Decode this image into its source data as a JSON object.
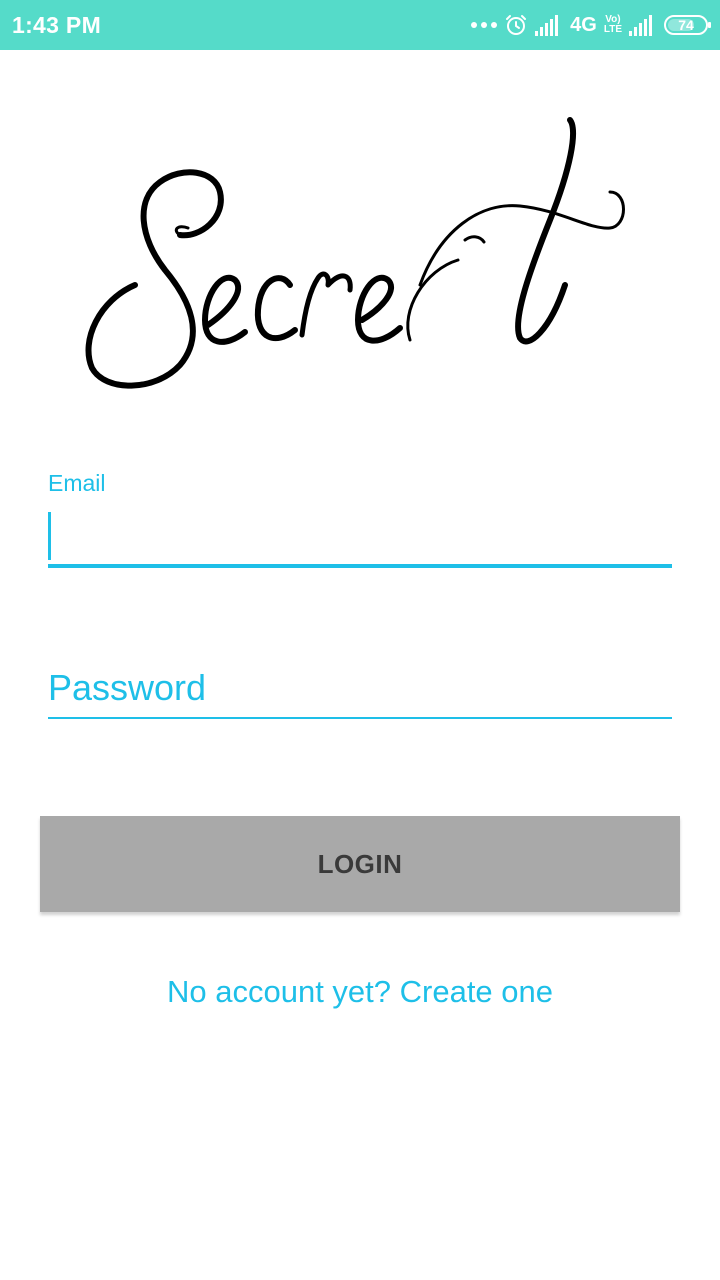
{
  "status_bar": {
    "time": "1:43 PM",
    "network": "4G",
    "volte_top": "Vo)",
    "volte_bottom": "LTE",
    "battery_level": 74,
    "battery_text": "74",
    "icons": [
      "more-dots-icon",
      "alarm-icon",
      "signal-icon",
      "signal-icon-2",
      "battery-icon"
    ]
  },
  "logo": {
    "text": "Secret"
  },
  "form": {
    "email_label": "Email",
    "email_value": "",
    "password_placeholder": "Password",
    "password_value": "",
    "login_label": "LOGIN",
    "create_account_link": "No account yet? Create one"
  },
  "colors": {
    "status_bar": "#55dbc9",
    "accent": "#1ebfe8",
    "button_bg": "#a9a9a9",
    "button_text": "#3a3a3a"
  }
}
